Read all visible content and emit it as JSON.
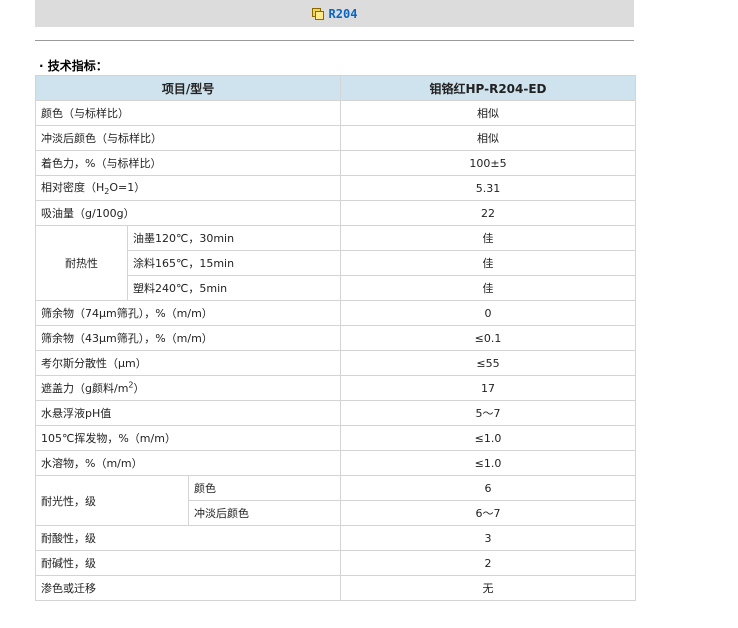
{
  "header": {
    "product_code": "R204",
    "icon": "document-stack-icon"
  },
  "section": {
    "title": "· 技术指标："
  },
  "table": {
    "col_item": "项目/型号",
    "col_model": "钼铬红HP-R204-ED",
    "rows": {
      "color": {
        "label": "颜色（与标样比）",
        "value": "相似"
      },
      "reduced_color": {
        "label": "冲淡后颜色（与标样比）",
        "value": "相似"
      },
      "tinting": {
        "label": "着色力，%（与标样比）",
        "value": "100±5"
      },
      "density": {
        "label_pre": "相对密度（H",
        "label_sub": "2",
        "label_post": "O=1）",
        "value": "5.31"
      },
      "oil": {
        "label": "吸油量（g/100g）",
        "value": "22"
      },
      "heat": {
        "label": "耐热性",
        "sub": [
          {
            "label": "油墨120℃，30min",
            "value": "佳"
          },
          {
            "label": "涂料165℃，15min",
            "value": "佳"
          },
          {
            "label": "塑料240℃，5min",
            "value": "佳"
          }
        ]
      },
      "sieve74": {
        "label": "筛余物（74μm筛孔），%（m/m）",
        "value": "0"
      },
      "sieve43": {
        "label": "筛余物（43μm筛孔），%（m/m）",
        "value": "≤0.1"
      },
      "hegman": {
        "label": "考尔斯分散性（μm）",
        "value": "≤55"
      },
      "hiding": {
        "label_pre": "遮盖力（g颜料/m",
        "label_sup": "2",
        "label_post": "）",
        "value": "17"
      },
      "ph": {
        "label": "水悬浮液pH值",
        "value": "5～7"
      },
      "volatile": {
        "label": "105℃挥发物，%（m/m）",
        "value": "≤1.0"
      },
      "soluble": {
        "label": "水溶物，%（m/m）",
        "value": "≤1.0"
      },
      "light": {
        "label": "耐光性，级",
        "sub": [
          {
            "label": "颜色",
            "value": "6"
          },
          {
            "label": "冲淡后颜色",
            "value": "6～7"
          }
        ]
      },
      "acid": {
        "label": "耐酸性，级",
        "value": "3"
      },
      "alkali": {
        "label": "耐碱性，级",
        "value": "2"
      },
      "bleed": {
        "label": "渗色或迁移",
        "value": "无"
      }
    }
  }
}
